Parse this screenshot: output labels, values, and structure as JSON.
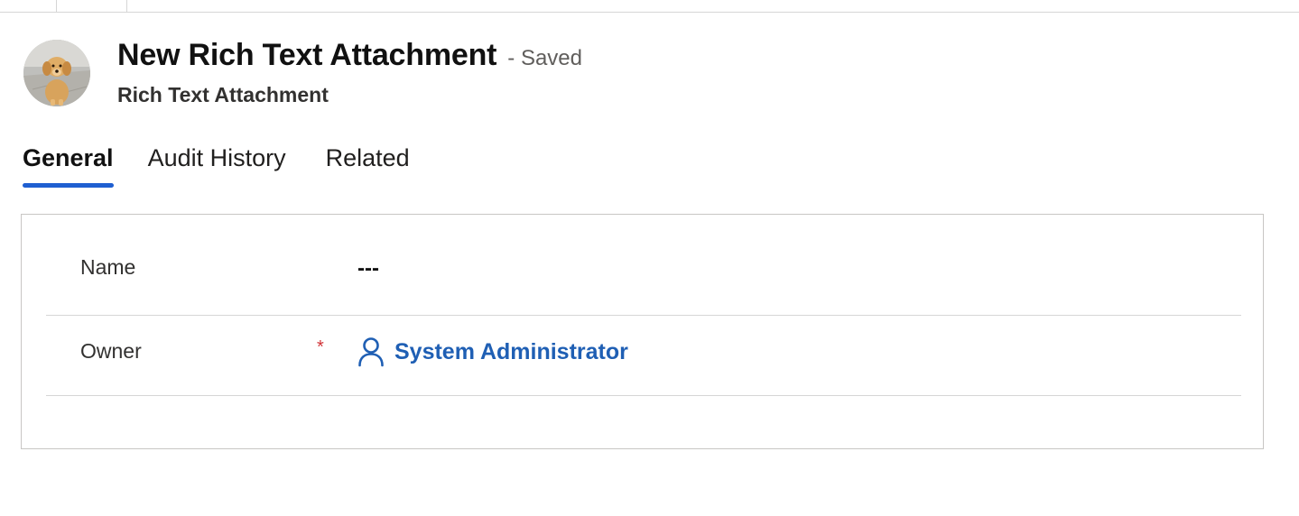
{
  "header": {
    "title": "New Rich Text Attachment",
    "save_status": "- Saved",
    "entity_name": "Rich Text Attachment",
    "avatar_icon": "puppy-photo-avatar"
  },
  "tabs": [
    {
      "label": "General",
      "active": true
    },
    {
      "label": "Audit History",
      "active": false
    },
    {
      "label": "Related",
      "active": false
    }
  ],
  "form": {
    "fields": [
      {
        "label": "Name",
        "value": "---",
        "required": false
      },
      {
        "label": "Owner",
        "value": "System Administrator",
        "required": true,
        "required_mark": "*",
        "icon": "person-icon"
      }
    ]
  },
  "colors": {
    "accent": "#1f5fd1",
    "link": "#1f5fb4",
    "required": "#d13438"
  }
}
